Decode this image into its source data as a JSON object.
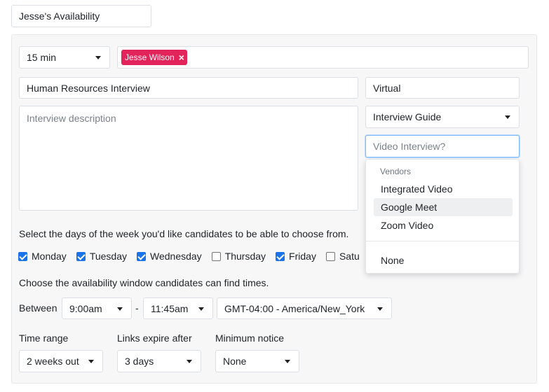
{
  "title_input": {
    "value": "Jesse's Availability"
  },
  "duration": {
    "value": "15 min"
  },
  "attendees": [
    {
      "name": "Jesse Wilson",
      "remove_icon": "close-icon",
      "color": "#e2245a"
    }
  ],
  "interview_name": {
    "value": "Human Resources Interview"
  },
  "location": {
    "value": "Virtual"
  },
  "description": {
    "placeholder": "Interview description"
  },
  "guide_select": {
    "value": "Interview Guide"
  },
  "video_input": {
    "placeholder": "Video Interview?",
    "focus_color": "#80bdff"
  },
  "video_dropdown": {
    "header": "Vendors",
    "options": [
      "Integrated Video",
      "Google Meet",
      "Zoom Video"
    ],
    "highlighted": "Google Meet",
    "extra_option": "None"
  },
  "days": {
    "prompt": "Select the days of the week you'd like candidates to be able to choose from.",
    "items": [
      {
        "label": "Monday",
        "checked": true
      },
      {
        "label": "Tuesday",
        "checked": true
      },
      {
        "label": "Wednesday",
        "checked": true
      },
      {
        "label": "Thursday",
        "checked": false
      },
      {
        "label": "Friday",
        "checked": true
      },
      {
        "label": "Satu",
        "checked": false
      }
    ],
    "check_color": "#1a73e8"
  },
  "window": {
    "prompt": "Choose the availability window candidates can find times.",
    "between_label": "Between",
    "start": "9:00am",
    "separator": "-",
    "end": "11:45am",
    "timezone": "GMT-04:00 - America/New_York"
  },
  "time_range": {
    "label": "Time range",
    "value": "2 weeks out"
  },
  "links_expire": {
    "label": "Links expire after",
    "value": "3 days"
  },
  "minimum_notice": {
    "label": "Minimum notice",
    "value": "None"
  }
}
